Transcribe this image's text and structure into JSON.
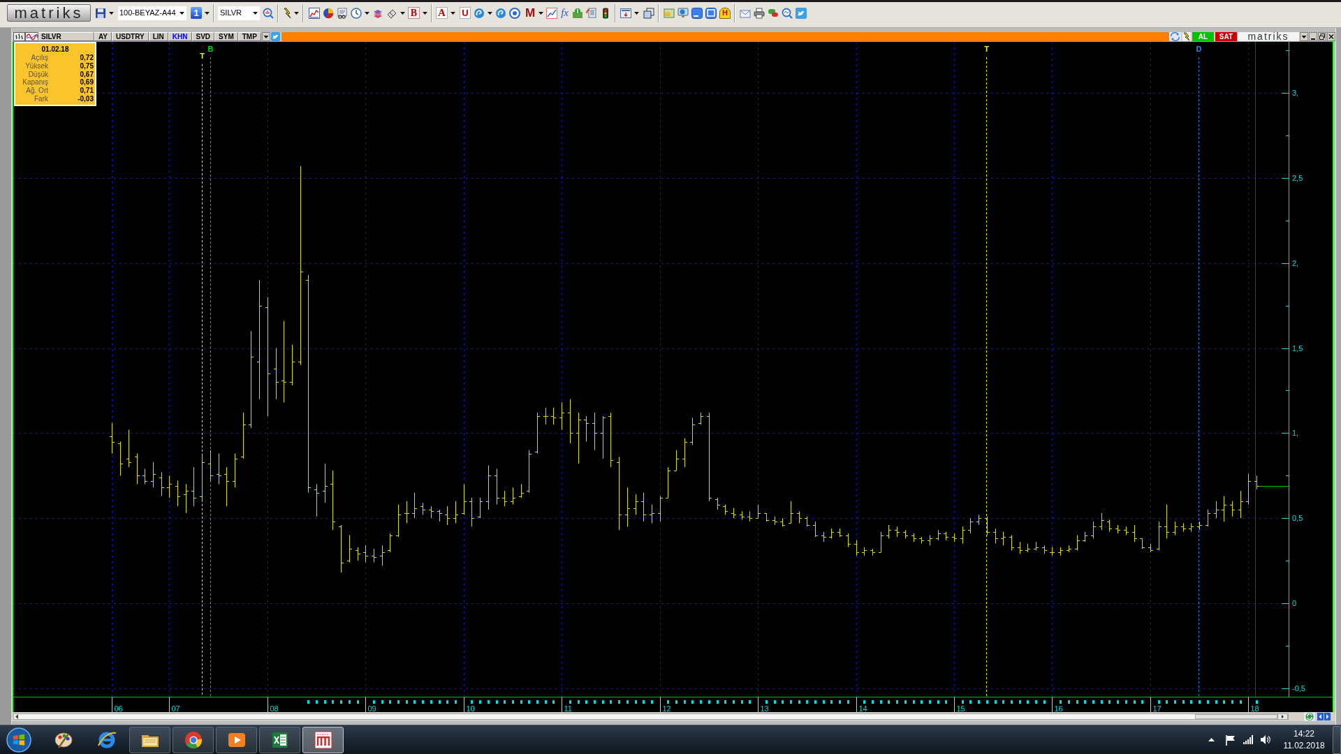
{
  "toolbar": {
    "logo": "matriks",
    "layout_combo": "100-BEYAZ-A44",
    "page_button": "1",
    "symbol_combo": "SILVR",
    "letter_buttons": [
      "B",
      "A",
      "U",
      "M",
      "fx",
      "H"
    ]
  },
  "chart_window": {
    "symbol": "SILVR",
    "tabs": [
      {
        "label": "AY",
        "on": false
      },
      {
        "label": "USDTRY",
        "on": false
      },
      {
        "label": "LIN",
        "on": false
      },
      {
        "label": "KHN",
        "on": true
      },
      {
        "label": "SVD",
        "on": false
      },
      {
        "label": "SYM",
        "on": false
      },
      {
        "label": "TMP",
        "on": false
      }
    ],
    "buy_button": "AL",
    "sell_button": "SAT",
    "logo": "matriks"
  },
  "info_box": {
    "date": "01.02.18",
    "rows": [
      {
        "label": "Açılış",
        "value": "0,72"
      },
      {
        "label": "Yüksek",
        "value": "0,75"
      },
      {
        "label": "Düşük",
        "value": "0,67"
      },
      {
        "label": "Kapanış",
        "value": "0,69"
      },
      {
        "label": "Ağ. Ort",
        "value": "0,71"
      },
      {
        "label": "Fark",
        "value": "-0,03"
      }
    ]
  },
  "chart": {
    "markers": [
      {
        "label": "T",
        "color": "#f0f000"
      },
      {
        "label": "B",
        "color": "#00e000"
      },
      {
        "label": "T",
        "color": "#f0f000"
      },
      {
        "label": "D",
        "color": "#2f86e8"
      }
    ],
    "y_axis_labels": [
      "3,",
      "2,5",
      "2,",
      "1,5",
      "1,",
      "0,5",
      "0",
      "-0,5"
    ],
    "x_axis_labels": [
      "06",
      "07",
      "08",
      "09",
      "10",
      "11",
      "12",
      "13",
      "14",
      "15",
      "16",
      "17",
      "18"
    ]
  },
  "taskbar": {
    "apps": [
      {
        "kind": "paint",
        "running": false,
        "selected": false
      },
      {
        "kind": "ie",
        "running": false,
        "selected": false
      },
      {
        "kind": "explorer",
        "running": true,
        "selected": false
      },
      {
        "kind": "chrome",
        "running": true,
        "selected": false
      },
      {
        "kind": "player",
        "running": true,
        "selected": false
      },
      {
        "kind": "excel",
        "running": true,
        "selected": false
      },
      {
        "kind": "matriks",
        "running": true,
        "selected": true
      }
    ],
    "clock": {
      "time": "14:22",
      "date": "11.02.2018"
    }
  }
}
